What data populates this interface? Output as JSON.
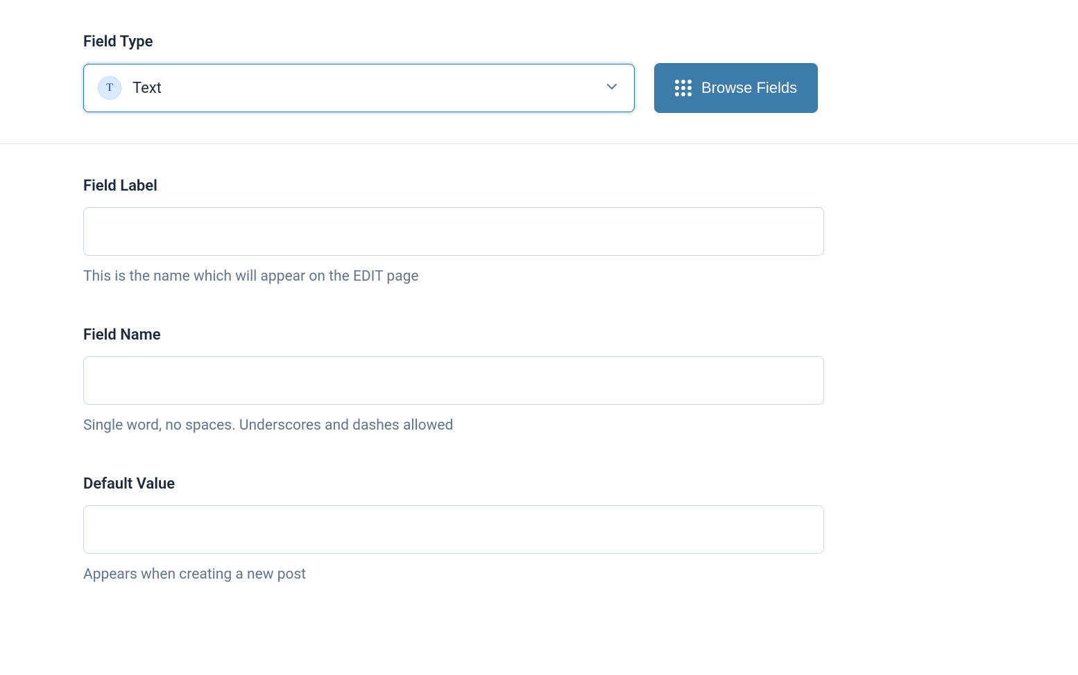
{
  "fieldType": {
    "label": "Field Type",
    "selectedValue": "Text",
    "iconLetter": "T",
    "browseButtonLabel": "Browse Fields"
  },
  "fieldLabel": {
    "label": "Field Label",
    "value": "",
    "helpText": "This is the name which will appear on the EDIT page"
  },
  "fieldName": {
    "label": "Field Name",
    "value": "",
    "helpText": "Single word, no spaces. Underscores and dashes allowed"
  },
  "defaultValue": {
    "label": "Default Value",
    "value": "",
    "helpText": "Appears when creating a new post"
  }
}
